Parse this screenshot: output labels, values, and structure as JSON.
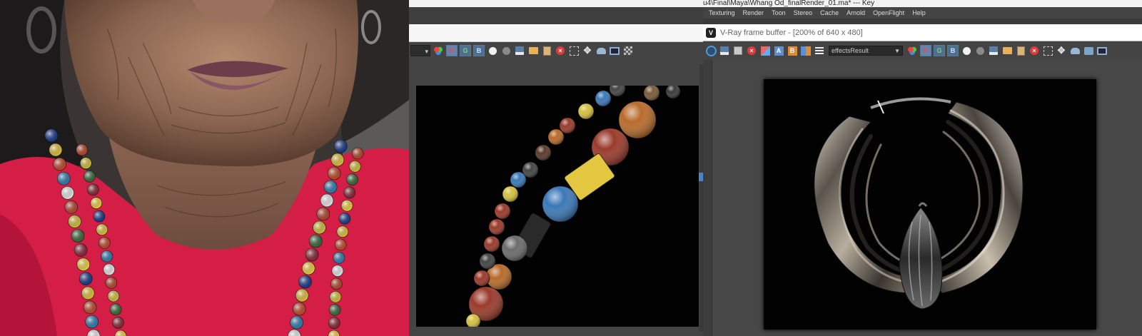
{
  "maya": {
    "path_title": "u4\\Final\\Maya\\Whang Od_finalRender_01.ma* --- Key",
    "menus": [
      "Texturing",
      "Render",
      "Toon",
      "Stereo",
      "Cache",
      "Arnold",
      "OpenFlight",
      "Help"
    ],
    "render_toolbar": {
      "channel_labels": [
        "R",
        "G",
        "B"
      ]
    }
  },
  "vfb": {
    "window_title": "V-Ray frame buffer - [200% of 640 x 480]",
    "logo_letter": "V",
    "toolbar": {
      "channel_value": "effectsResult",
      "channel_labels": [
        "R",
        "G",
        "B"
      ],
      "ab_labels": [
        "A",
        "B"
      ]
    }
  },
  "colors": {
    "app_background": "#444444",
    "render_background": "#020202",
    "menubar_text": "#dddddd",
    "channel_button": "#4f6f8f",
    "stop_icon": "#e23b3b",
    "photo_shirt": "#d41e45"
  },
  "icons": [
    "layers-icon",
    "white-sphere-icon",
    "grey-sphere-icon",
    "save-icon",
    "folder-icon",
    "clipboard-icon",
    "stop-render-icon",
    "region-icon",
    "move-icon",
    "teapot-icon",
    "frame-icon",
    "checker-icon",
    "power-icon",
    "menu-icon",
    "pin-icon"
  ]
}
